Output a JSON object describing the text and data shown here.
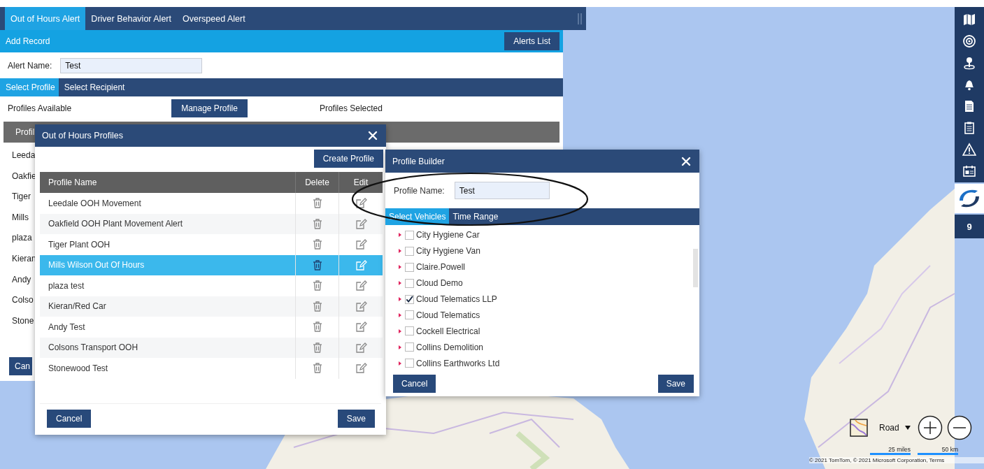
{
  "alert_tabs": [
    {
      "label": "Out of Hours Alert",
      "selected": true
    },
    {
      "label": "Driver Behavior Alert",
      "selected": false
    },
    {
      "label": "Overspeed Alert",
      "selected": false
    }
  ],
  "toolbar": {
    "title": "Add Record",
    "button": "Alerts List"
  },
  "alert_name": {
    "label": "Alert Name:",
    "value": "Test"
  },
  "section_tabs": [
    {
      "label": "Select Profile",
      "selected": true
    },
    {
      "label": "Select Recipient",
      "selected": false
    }
  ],
  "profiles_available": "Profiles Available",
  "manage_button": "Manage Profile",
  "profiles_selected": "Profiles Selected",
  "background_table": {
    "header": "Profil",
    "rows": [
      "Leeda",
      "Oakfie",
      "Tiger",
      "Mills",
      "plaza",
      "Kieran",
      "Andy",
      "Colso",
      "Stone"
    ],
    "button": "Can"
  },
  "profiles_dialog": {
    "title": "Out of Hours Profiles",
    "create_button": "Create Profile",
    "columns": [
      "Profile Name",
      "Delete",
      "Edit"
    ],
    "rows": [
      {
        "name": "Leedale OOH Movement",
        "selected": false
      },
      {
        "name": "Oakfield OOH Plant Movement Alert",
        "selected": false
      },
      {
        "name": "Tiger Plant OOH",
        "selected": false
      },
      {
        "name": "Mills Wilson Out Of Hours",
        "selected": true
      },
      {
        "name": "plaza test",
        "selected": false
      },
      {
        "name": "Kieran/Red Car",
        "selected": false
      },
      {
        "name": "Andy Test",
        "selected": false
      },
      {
        "name": "Colsons Transport OOH",
        "selected": false
      },
      {
        "name": "Stonewood Test",
        "selected": false
      }
    ],
    "cancel": "Cancel",
    "save": "Save"
  },
  "builder_dialog": {
    "title": "Profile Builder",
    "name_label": "Profile Name:",
    "name_value": "Test",
    "tabs": [
      {
        "label": "Select Vehicles",
        "selected": true
      },
      {
        "label": "Time Range",
        "selected": false
      }
    ],
    "vehicles": [
      {
        "name": "City Hygiene Car",
        "checked": false
      },
      {
        "name": "City Hygiene Van",
        "checked": false
      },
      {
        "name": "Claire.Powell",
        "checked": false
      },
      {
        "name": "Cloud Demo",
        "checked": false
      },
      {
        "name": "Cloud Telematics LLP",
        "checked": true
      },
      {
        "name": "Cloud Telematics",
        "checked": false
      },
      {
        "name": "Cockell Electrical",
        "checked": false
      },
      {
        "name": "Collins Demolition",
        "checked": false
      },
      {
        "name": "Collins Earthworks Ltd",
        "checked": false
      }
    ],
    "cancel": "Cancel",
    "save": "Save"
  },
  "sidebar": {
    "badge": "9"
  },
  "map_controls": {
    "style": "Road",
    "scale": [
      "25 miles",
      "50 km"
    ],
    "attribution": "© 2021 TomTom, © 2021 Microsoft Corporation, Terms"
  }
}
